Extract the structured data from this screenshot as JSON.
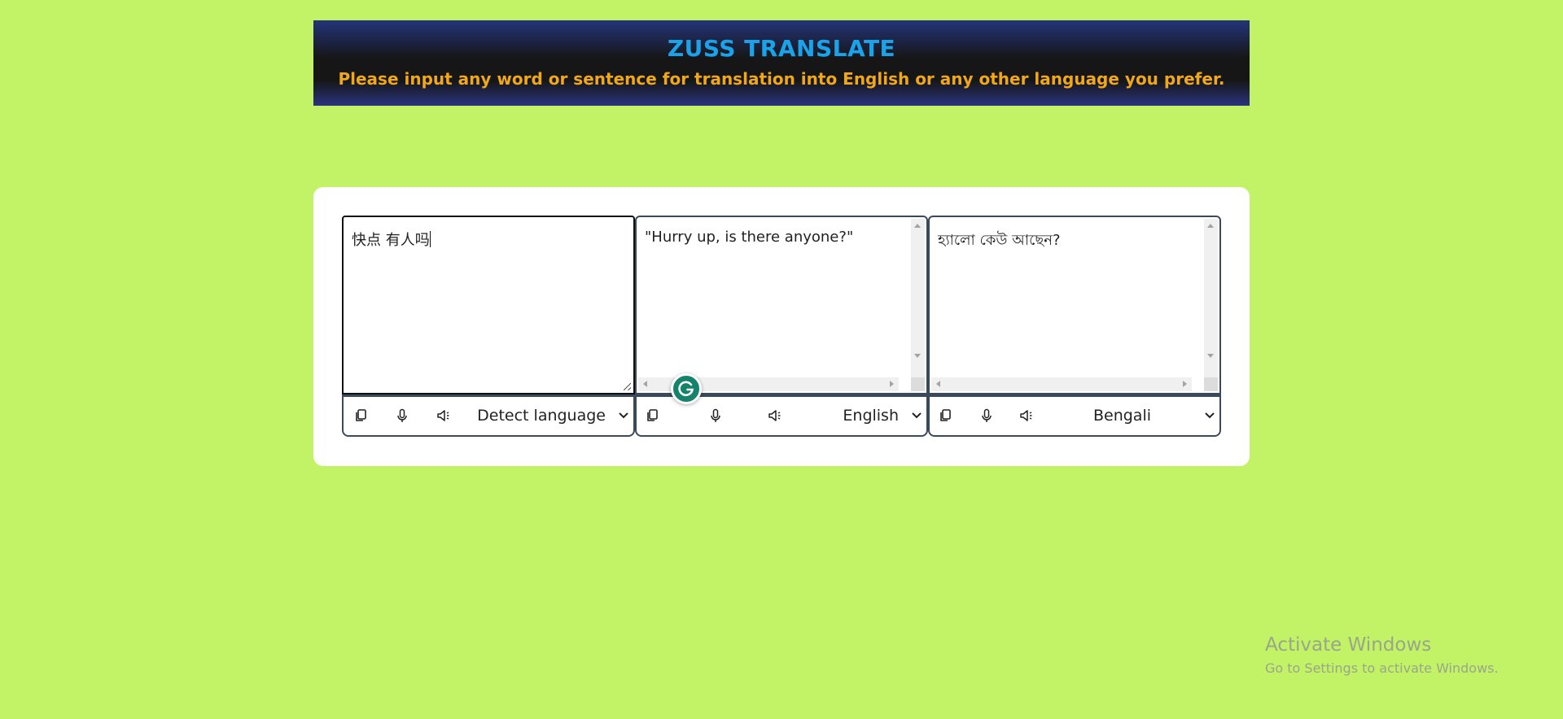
{
  "header": {
    "title": "ZUSS TRANSLATE",
    "subtitle": "Please input any word or sentence for translation into English or any other language you prefer."
  },
  "panels": [
    {
      "text": "快点 有人吗",
      "language": "Detect language"
    },
    {
      "text": "\"Hurry up, is there anyone?\"",
      "language": "English"
    },
    {
      "text": "হ্যালো কেউ আছেন?",
      "language": "Bengali"
    }
  ],
  "icons": {
    "copy": "copy-icon",
    "mic": "microphone-icon",
    "speaker": "speaker-icon",
    "dropdown": "chevron-down-icon",
    "grammarly": "grammarly-icon"
  },
  "colors": {
    "page_background": "#c2f265",
    "title": "#1aa3e8",
    "subtitle": "#f0a818",
    "border": "#3b4a5a",
    "grammarly": "#15826b"
  },
  "watermark": {
    "line1": "Activate Windows",
    "line2": "Go to Settings to activate Windows."
  }
}
